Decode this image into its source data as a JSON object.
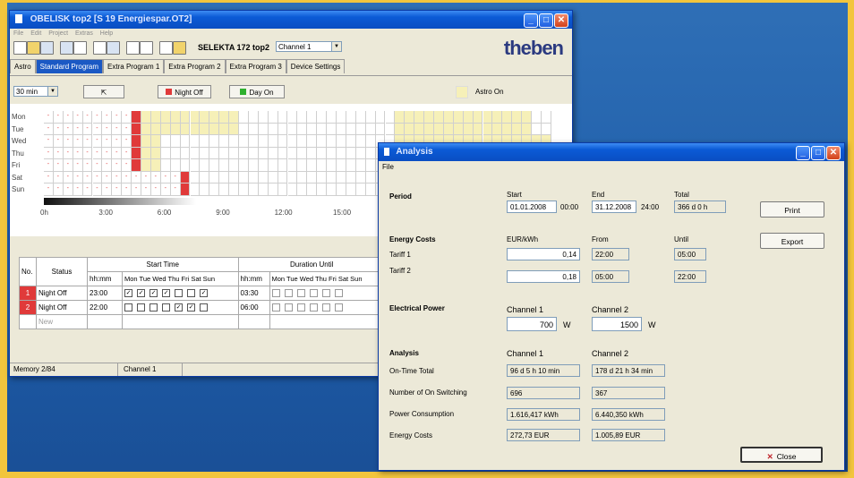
{
  "main_window": {
    "title": "OBELISK top2   [S 19 Energiespar.OT2]",
    "menu": [
      "File",
      "Edit",
      "Project",
      "Extras",
      "Help"
    ],
    "device": "SELEKTA 172 top2",
    "channel_select": "Channel 1",
    "brand": "theben",
    "tabs": [
      "Astro",
      "Standard Program",
      "Extra Program 1",
      "Extra Program 2",
      "Extra Program 3",
      "Device Settings"
    ],
    "active_tab": "Standard Program",
    "resolution_select": "30 min",
    "night_off_label": "Night Off",
    "day_on_label": "Day On",
    "astro_on_label": "Astro On",
    "days": [
      "Mon",
      "Tue",
      "Wed",
      "Thu",
      "Fri",
      "Sat",
      "Sun"
    ],
    "hour_labels": [
      "0h",
      "3:00",
      "6:00",
      "9:00",
      "12:00",
      "15:00"
    ],
    "table": {
      "h_no": "No.",
      "h_status": "Status",
      "h_start": "Start Time",
      "h_duration": "Duration Until",
      "h_hhmm": "hh:mm",
      "day_heads": [
        "Mon",
        "Tue",
        "Wed",
        "Thu",
        "Fri",
        "Sat",
        "Sun"
      ],
      "rows": [
        {
          "no": "1",
          "status": "Night Off",
          "time": "23:00",
          "days": [
            true,
            true,
            true,
            true,
            false,
            false,
            true
          ],
          "dur": "03:30"
        },
        {
          "no": "2",
          "status": "Night Off",
          "time": "22:00",
          "days": [
            false,
            false,
            false,
            false,
            true,
            true,
            false
          ],
          "dur": "06:00"
        }
      ],
      "new_label": "New"
    },
    "status_memory": "Memory 2/84",
    "status_channel": "Channel 1"
  },
  "analysis": {
    "title": "Analysis",
    "menu_file": "File",
    "period_label": "Period",
    "start_label": "Start",
    "start_date": "01.01.2008",
    "start_time": "00:00",
    "end_label": "End",
    "end_date": "31.12.2008",
    "end_time": "24:00",
    "total_label": "Total",
    "total_value": "366 d  0 h",
    "print_label": "Print",
    "export_label": "Export",
    "energy_costs_label": "Energy Costs",
    "eur_label": "EUR/kWh",
    "from_label": "From",
    "until_label": "Until",
    "tariff1_label": "Tariff 1",
    "tariff1_value": "0,14",
    "tariff1_from": "22:00",
    "tariff1_until": "05:00",
    "tariff2_label": "Tariff 2",
    "tariff2_value": "0,18",
    "tariff2_from": "05:00",
    "tariff2_until": "22:00",
    "electrical_power_label": "Electrical Power",
    "channel1_label": "Channel  1",
    "channel2_label": "Channel  2",
    "power_ch1": "700",
    "power_ch2": "1500",
    "unit_w": "W",
    "analysis_label": "Analysis",
    "on_time_label": "On-Time Total",
    "on_time_ch1": "96 d  5 h  10 min",
    "on_time_ch2": "178 d  21 h  34 min",
    "switching_label": "Number of On Switching",
    "switching_ch1": "696",
    "switching_ch2": "367",
    "consumption_label": "Power Consumption",
    "consumption_ch1": "1.616,417 kWh",
    "consumption_ch2": "6.440,350 kWh",
    "costs_label": "Energy Costs",
    "costs_ch1": "272,73 EUR",
    "costs_ch2": "1.005,89 EUR",
    "close_label": "Close"
  },
  "colors": {
    "night": "#e03a3a",
    "day": "#2fb02f",
    "astro": "#f6f0b8"
  }
}
